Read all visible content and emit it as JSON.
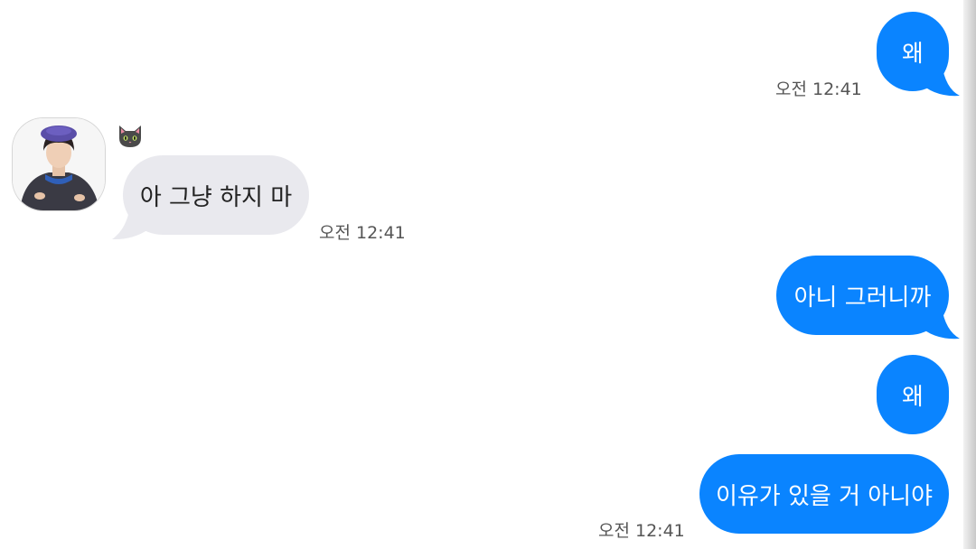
{
  "sender_name": "🐱",
  "messages": [
    {
      "direction": "sent",
      "text": "왜",
      "time": "오전 12:41"
    },
    {
      "direction": "received",
      "text": "아 그냥 하지 마",
      "time": "오전 12:41"
    },
    {
      "direction": "sent",
      "text": "아니 그러니까",
      "time": ""
    },
    {
      "direction": "sent",
      "text": "왜",
      "time": ""
    },
    {
      "direction": "sent",
      "text": "이유가 있을 거 아니야",
      "time": "오전 12:41"
    }
  ],
  "colors": {
    "sent_bubble": "#0a84ff",
    "received_bubble": "#e9e9ee",
    "sent_text": "#ffffff",
    "received_text": "#222222",
    "timestamp": "#555555"
  },
  "icons": {
    "sender_icon": "cat-face-icon",
    "avatar": "contact-avatar-photo"
  }
}
